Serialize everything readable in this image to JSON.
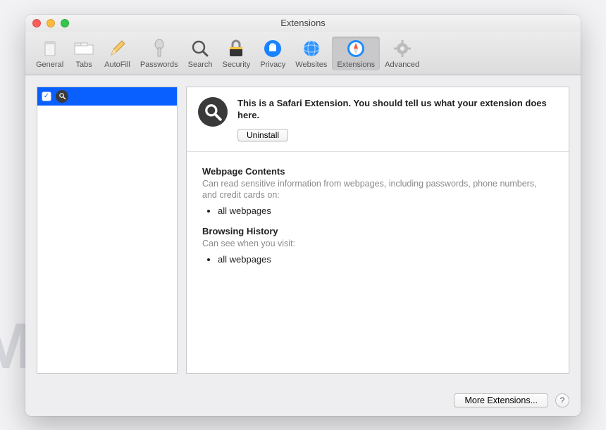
{
  "watermark": "MALWARETIPS",
  "window": {
    "title": "Extensions"
  },
  "toolbar": [
    {
      "label": "General",
      "key": "general"
    },
    {
      "label": "Tabs",
      "key": "tabs"
    },
    {
      "label": "AutoFill",
      "key": "autofill"
    },
    {
      "label": "Passwords",
      "key": "passwords"
    },
    {
      "label": "Search",
      "key": "search"
    },
    {
      "label": "Security",
      "key": "security"
    },
    {
      "label": "Privacy",
      "key": "privacy"
    },
    {
      "label": "Websites",
      "key": "websites"
    },
    {
      "label": "Extensions",
      "key": "extensions",
      "active": true
    },
    {
      "label": "Advanced",
      "key": "advanced"
    }
  ],
  "sidebar": {
    "items": [
      {
        "checked": true,
        "icon": "magnifying-glass"
      }
    ]
  },
  "extension": {
    "description": "This is a Safari Extension. You should tell us what your extension does here.",
    "uninstall_label": "Uninstall"
  },
  "permissions": {
    "webpage_heading": "Webpage Contents",
    "webpage_desc": "Can read sensitive information from webpages, including passwords, phone numbers, and credit cards on:",
    "webpage_item": "all webpages",
    "history_heading": "Browsing History",
    "history_desc": "Can see when you visit:",
    "history_item": "all webpages"
  },
  "footer": {
    "more_label": "More Extensions...",
    "help_label": "?"
  }
}
